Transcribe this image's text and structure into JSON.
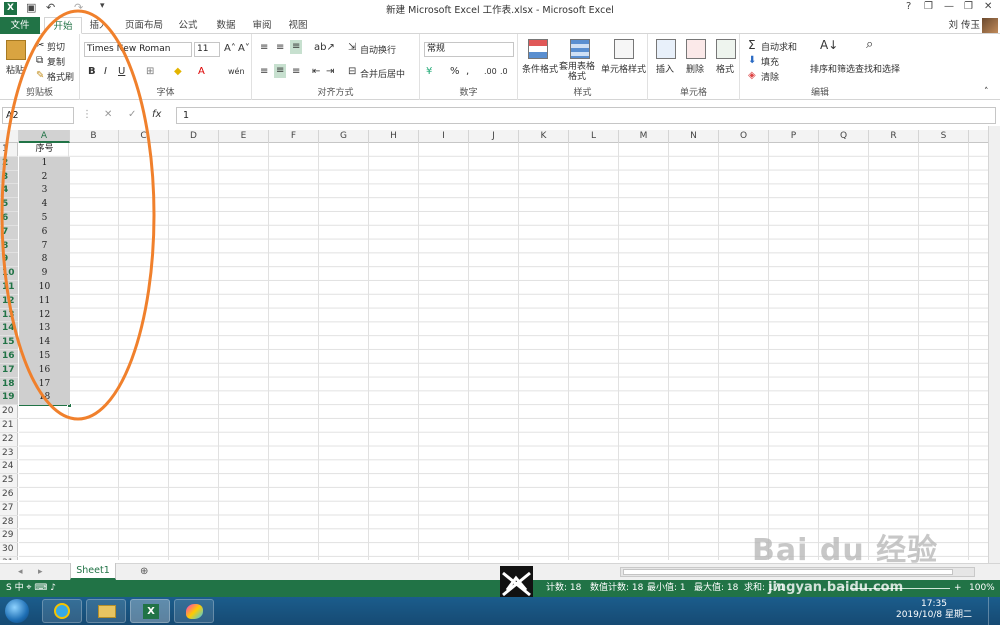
{
  "window": {
    "title": "新建 Microsoft Excel 工作表.xlsx - Microsoft Excel",
    "help": "?",
    "min": "—",
    "restore": "❐",
    "close": "✕",
    "user": "刘 传玉"
  },
  "tabs": [
    "文件",
    "开始",
    "插入",
    "页面布局",
    "公式",
    "数据",
    "审阅",
    "视图"
  ],
  "ribbon": {
    "clipboard": {
      "paste": "粘贴",
      "cut": "剪切",
      "copy": "复制",
      "format_painter": "格式刷",
      "label": "剪贴板"
    },
    "font": {
      "name": "Times New Roman",
      "size": "11",
      "bold": "B",
      "italic": "I",
      "underline": "U",
      "label": "字体"
    },
    "align": {
      "wrap": "自动换行",
      "merge": "合并后居中",
      "label": "对齐方式"
    },
    "number": {
      "format": "常规",
      "percent": "%",
      "comma": ",",
      "label": "数字"
    },
    "styles": {
      "conditional": "条件格式",
      "table": "套用表格格式",
      "cell": "单元格样式",
      "label": "样式"
    },
    "cells": {
      "insert": "插入",
      "delete": "删除",
      "format": "格式",
      "label": "单元格"
    },
    "editing": {
      "autosum": "自动求和",
      "fill": "填充",
      "clear": "清除",
      "sort": "排序和筛选",
      "find": "查找和选择",
      "label": "编辑"
    }
  },
  "formula": {
    "namebox": "A2",
    "value": "1"
  },
  "columns": [
    "A",
    "B",
    "C",
    "D",
    "E",
    "F",
    "G",
    "H",
    "I",
    "J",
    "K",
    "L",
    "M",
    "N",
    "O",
    "P",
    "Q",
    "R",
    "S"
  ],
  "rows": [
    "1",
    "2",
    "3",
    "4",
    "5",
    "6",
    "7",
    "8",
    "9",
    "10",
    "11",
    "12",
    "13",
    "14",
    "15",
    "16",
    "17",
    "18",
    "19",
    "20",
    "21",
    "22",
    "23",
    "24",
    "25",
    "26",
    "27",
    "28",
    "29",
    "30",
    "31"
  ],
  "cells_a": [
    "序号",
    "1",
    "2",
    "3",
    "4",
    "5",
    "6",
    "7",
    "8",
    "9",
    "10",
    "11",
    "12",
    "13",
    "14",
    "15",
    "16",
    "17",
    "18"
  ],
  "sheet": {
    "tab": "Sheet1"
  },
  "status": {
    "count": "计数: 18",
    "numcount": "数值计数: 18",
    "min": "最小值: 1",
    "max": "最大值: 18",
    "sum": "求和: 171",
    "zoom": "100%"
  },
  "taskbar": {
    "time": "17:35",
    "date": "2019/10/8 星期二"
  },
  "watermark": {
    "brand": "Bai du 经验",
    "url": "jingyan.baidu.com"
  },
  "colors": {
    "excel_green": "#217346",
    "annotation": "#f0802c"
  }
}
